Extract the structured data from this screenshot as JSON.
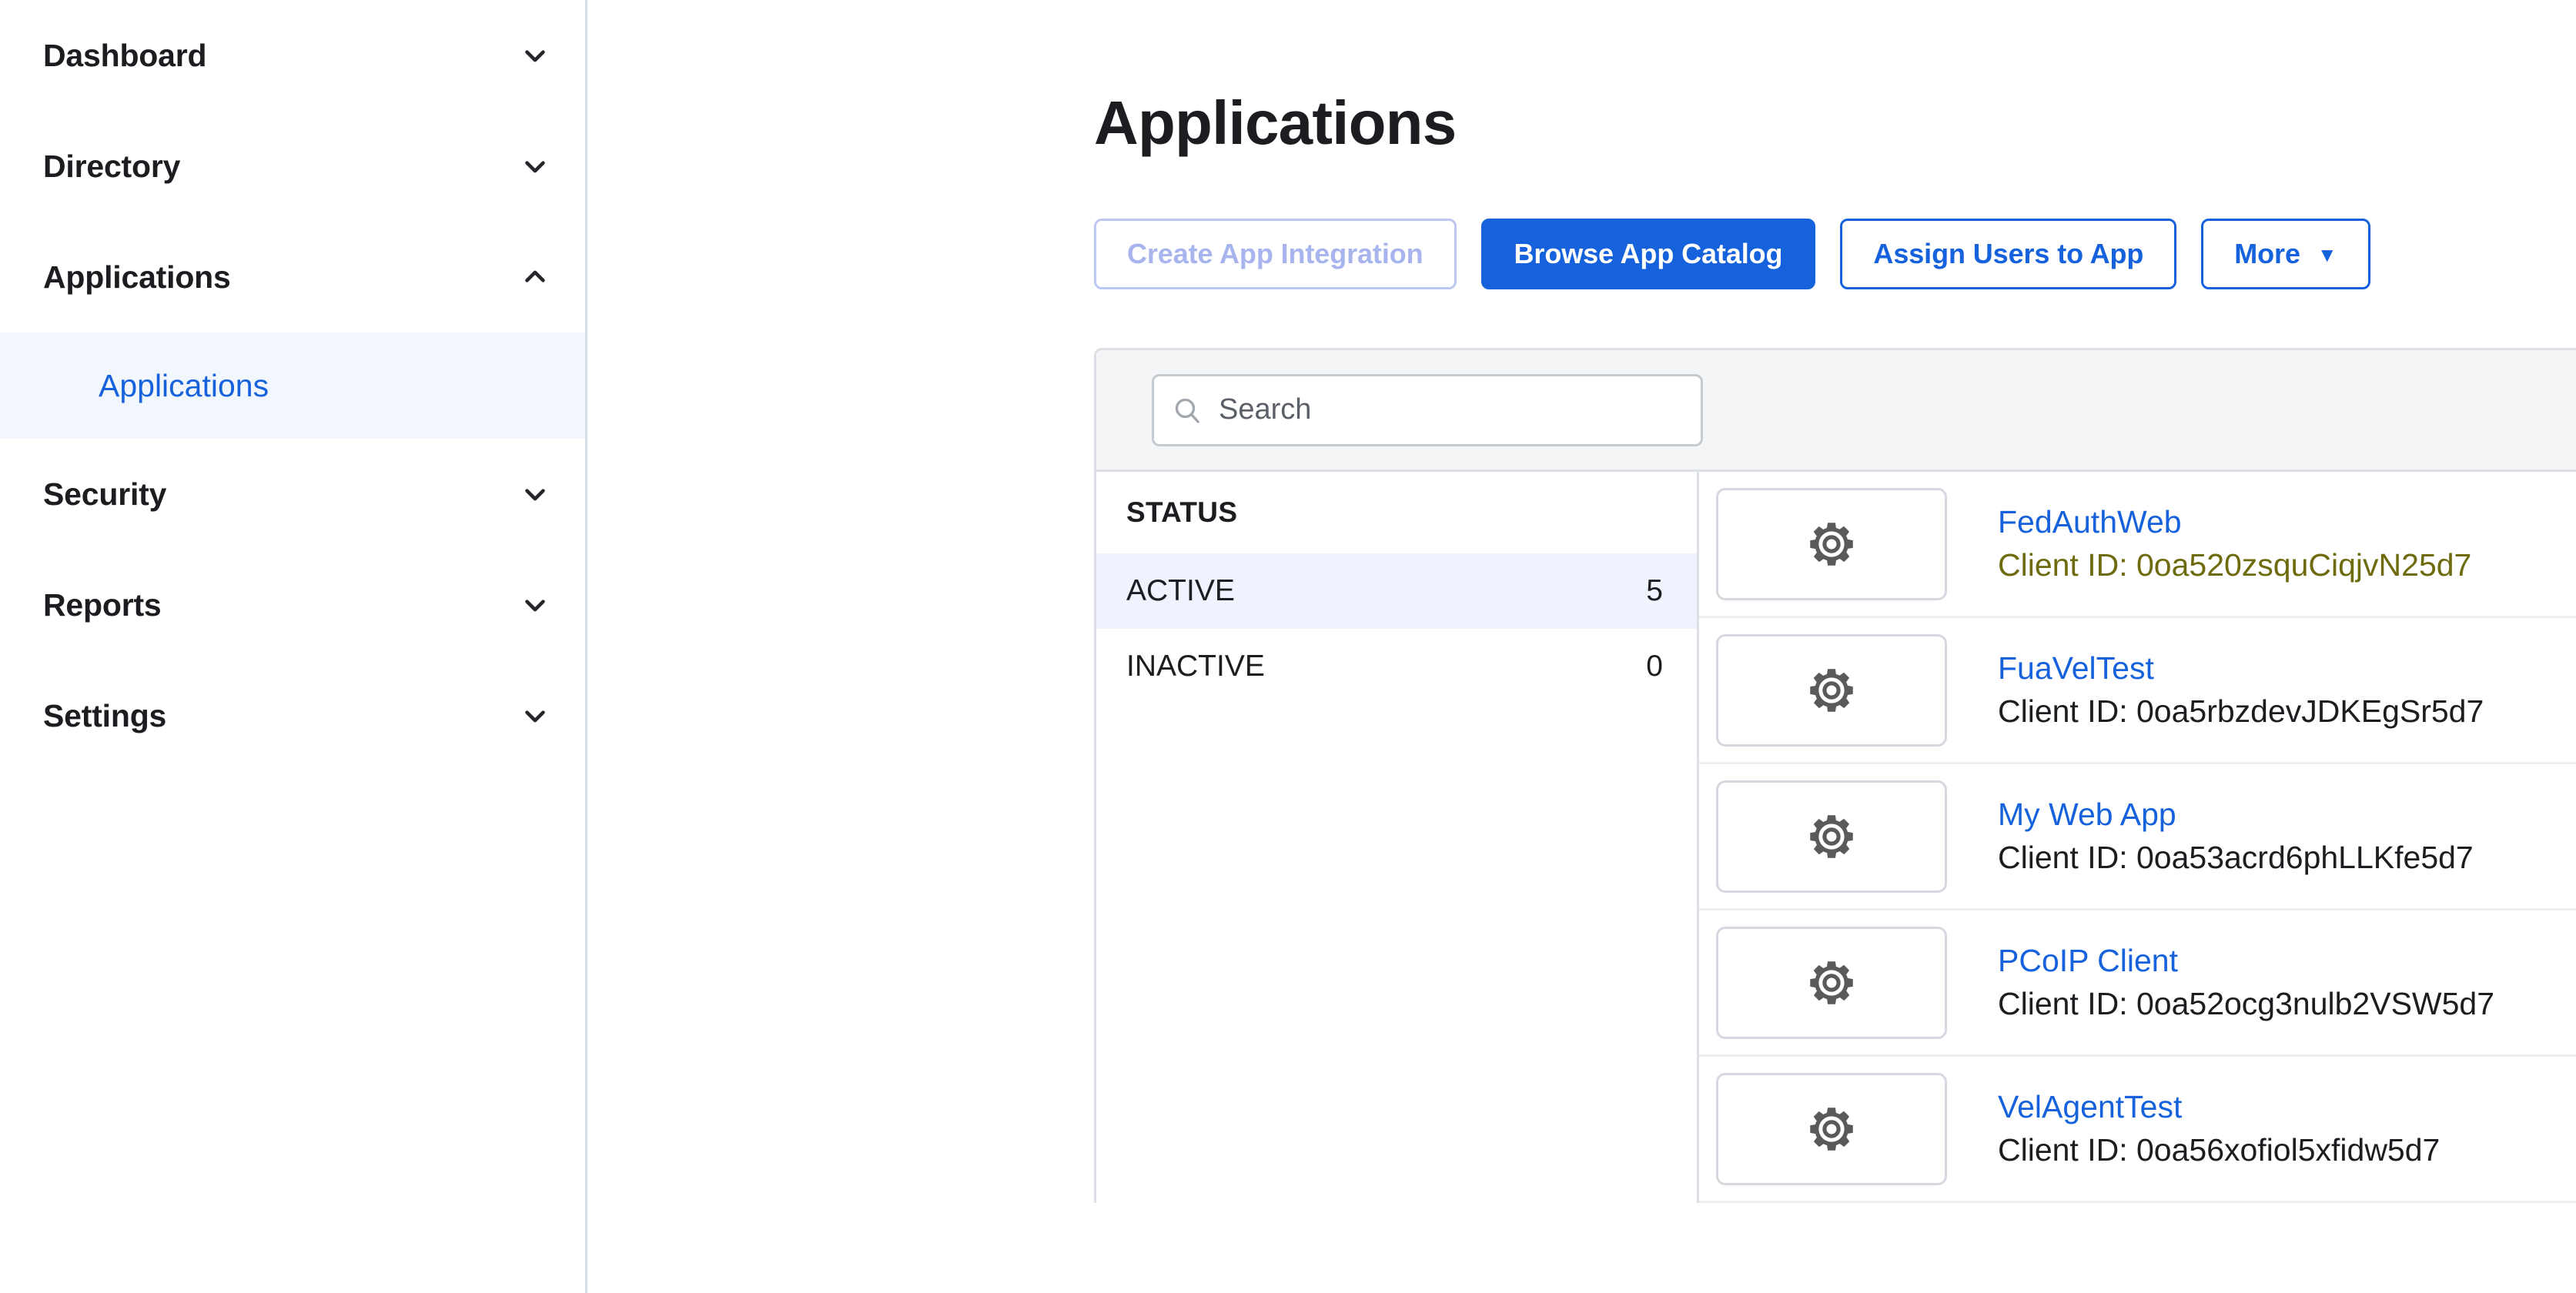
{
  "sidebar": {
    "items": [
      {
        "label": "Dashboard",
        "icon": "chevron-down-icon",
        "expanded": false
      },
      {
        "label": "Directory",
        "icon": "chevron-down-icon",
        "expanded": false
      },
      {
        "label": "Applications",
        "icon": "chevron-up-icon",
        "expanded": true
      },
      {
        "label": "Security",
        "icon": "chevron-down-icon",
        "expanded": false
      },
      {
        "label": "Reports",
        "icon": "chevron-down-icon",
        "expanded": false
      },
      {
        "label": "Settings",
        "icon": "chevron-down-icon",
        "expanded": false
      }
    ],
    "sub_item": {
      "label": "Applications",
      "selected": true
    }
  },
  "page": {
    "title": "Applications"
  },
  "toolbar": {
    "create_app_integration": "Create App Integration",
    "browse_app_catalog": "Browse App Catalog",
    "assign_users_to_app": "Assign Users to App",
    "more": "More",
    "more_caret": "▼"
  },
  "search": {
    "placeholder": "Search",
    "value": "",
    "icon": "search-icon"
  },
  "status_filter": {
    "header": "STATUS",
    "items": [
      {
        "label": "ACTIVE",
        "count": "5",
        "selected": true
      },
      {
        "label": "INACTIVE",
        "count": "0",
        "selected": false
      }
    ]
  },
  "app_list": {
    "client_id_prefix": "Client ID: ",
    "rows": [
      {
        "name": "FedAuthWeb",
        "client_id": "Client ID: 0oa520zsquCiqjvN25d7",
        "icon": "gear-icon",
        "highlighted": true
      },
      {
        "name": "FuaVelTest",
        "client_id": "Client ID: 0oa5rbzdevJDKEgSr5d7",
        "icon": "gear-icon",
        "highlighted": false
      },
      {
        "name": "My Web App",
        "client_id": "Client ID: 0oa53acrd6phLLKfe5d7",
        "icon": "gear-icon",
        "highlighted": false
      },
      {
        "name": "PCoIP Client",
        "client_id": "Client ID: 0oa52ocg3nulb2VSW5d7",
        "icon": "gear-icon",
        "highlighted": false
      },
      {
        "name": "VelAgentTest",
        "client_id": "Client ID: 0oa56xofiol5xfidw5d7",
        "icon": "gear-icon",
        "highlighted": false
      }
    ]
  },
  "colors": {
    "accent_blue": "#1662dd",
    "selected_row_bg": "#eef3fd",
    "highlight_marker": "#fbf58b",
    "text_dark": "#1d1d21",
    "disabled_blue": "#a7b4ee"
  }
}
